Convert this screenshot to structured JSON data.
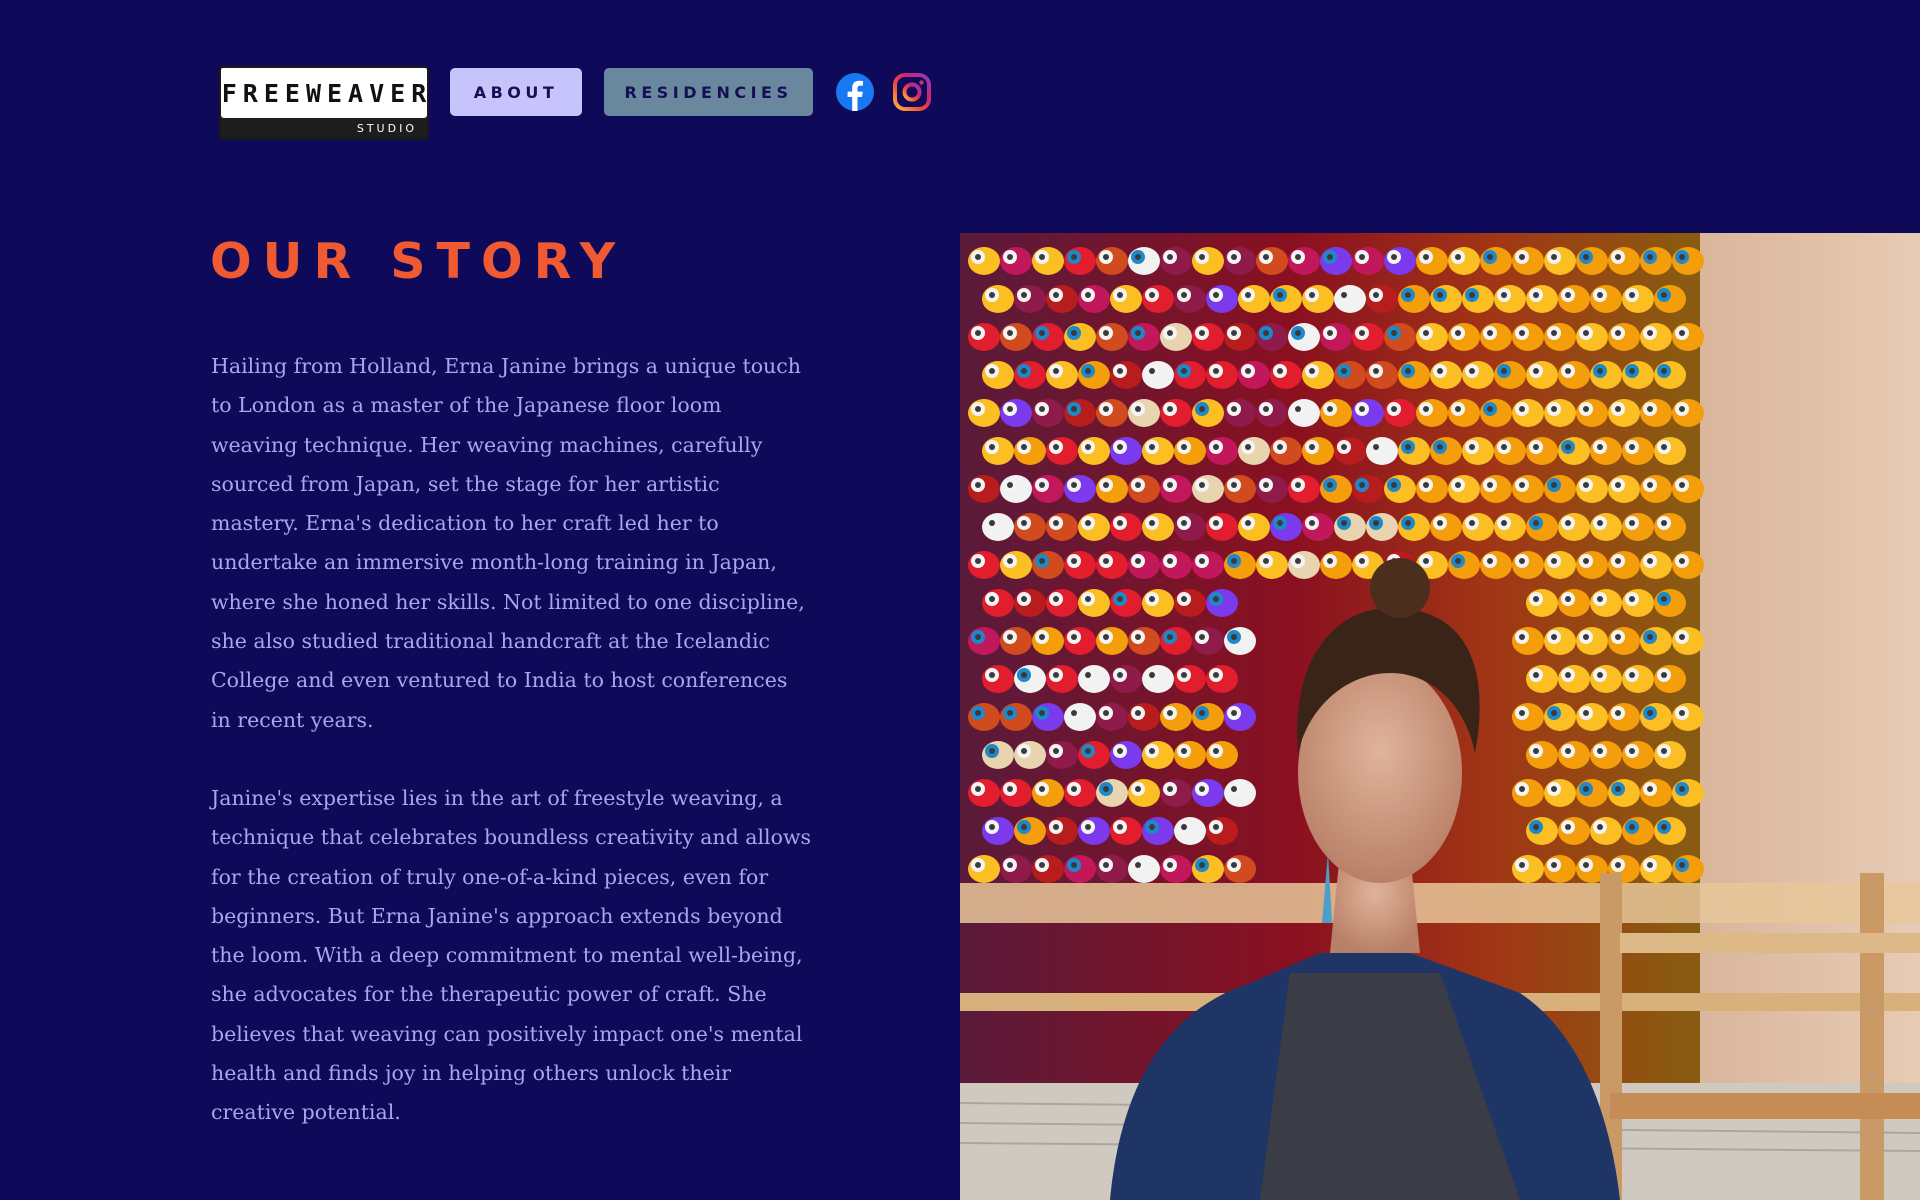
{
  "header": {
    "logo": {
      "main_text": "FREEWEAVER",
      "sub_text": "STUDIO"
    },
    "nav": [
      {
        "label": "ABOUT"
      },
      {
        "label": "RESIDENCIES"
      }
    ],
    "social": [
      {
        "icon": "facebook-icon"
      },
      {
        "icon": "instagram-icon"
      }
    ]
  },
  "content": {
    "title": "OUR STORY",
    "paragraphs": [
      "Hailing from Holland, Erna Janine brings a unique touch to London as a master of the Japanese floor loom weaving technique. Her weaving machines, carefully sourced from Japan, set the stage for her artistic mastery. Erna's dedication to her craft led her to undertake an immersive month-long training in Japan, where she honed her skills. Not limited to one discipline, she also studied traditional handcraft at the Icelandic College and even ventured to India to host conferences in recent years.",
      "Janine's expertise lies in the art of freestyle weaving, a technique that celebrates boundless creativity and allows for the creation of truly one-of-a-kind pieces, even for beginners. But Erna Janine's approach extends beyond the loom. With a deep commitment to mental well-being, she advocates for the therapeutic power of craft. She believes that weaving can positively impact one's mental health and finds joy in helping others unlock their creative potential."
    ]
  },
  "colors": {
    "background": "#0f0959",
    "title": "#f05a33",
    "body_text": "#a8a6ec",
    "about_button": "#c7c4fb",
    "residencies_button": "#69879d"
  }
}
